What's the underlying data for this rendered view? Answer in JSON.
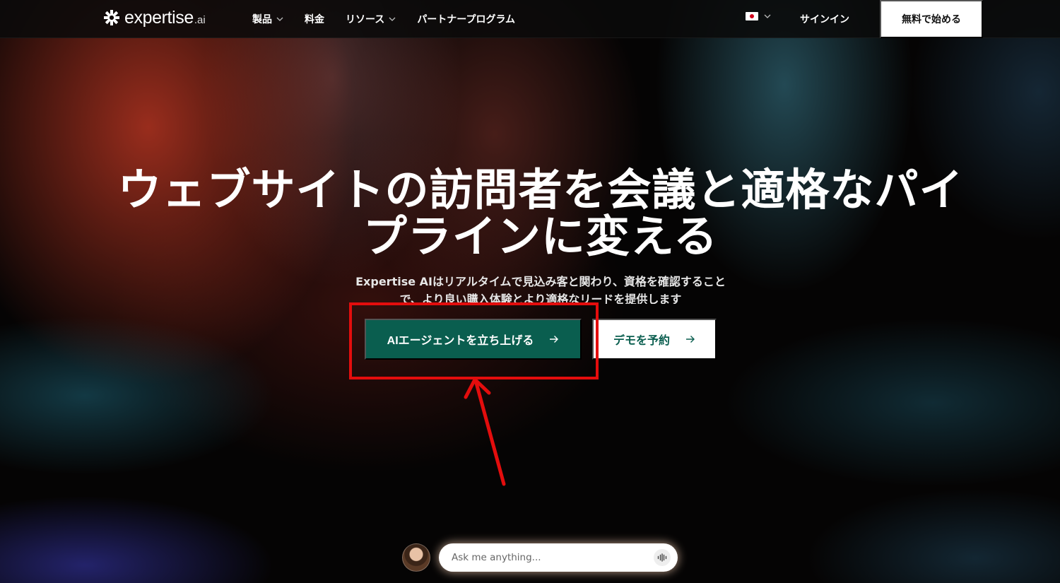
{
  "brand": {
    "name": "expertise",
    "suffix": ".ai"
  },
  "nav": {
    "items": [
      {
        "label": "製品",
        "has_dropdown": true
      },
      {
        "label": "料金",
        "has_dropdown": false
      },
      {
        "label": "リソース",
        "has_dropdown": true
      },
      {
        "label": "パートナープログラム",
        "has_dropdown": false
      }
    ],
    "language_icon": "japan-flag-icon",
    "signin_label": "サインイン",
    "start_label": "無料で始める"
  },
  "hero": {
    "title": "ウェブサイトの訪問者を会議と適格なパイプラインに変える",
    "subtitle": "Expertise AIはリアルタイムで見込み客と関わり、資格を確認することで、より良い購入体験とより適格なリードを提供します",
    "primary_cta": "AIエージェントを立ち上げる",
    "secondary_cta": "デモを予約"
  },
  "assistant": {
    "placeholder": "Ask me anything...",
    "voice_icon": "waveform-icon"
  },
  "annotation": {
    "color": "#e30d0d"
  },
  "colors": {
    "primary": "#0a5e4f",
    "annotation": "#e30d0d",
    "nav_bg": "#0a0a0a"
  }
}
